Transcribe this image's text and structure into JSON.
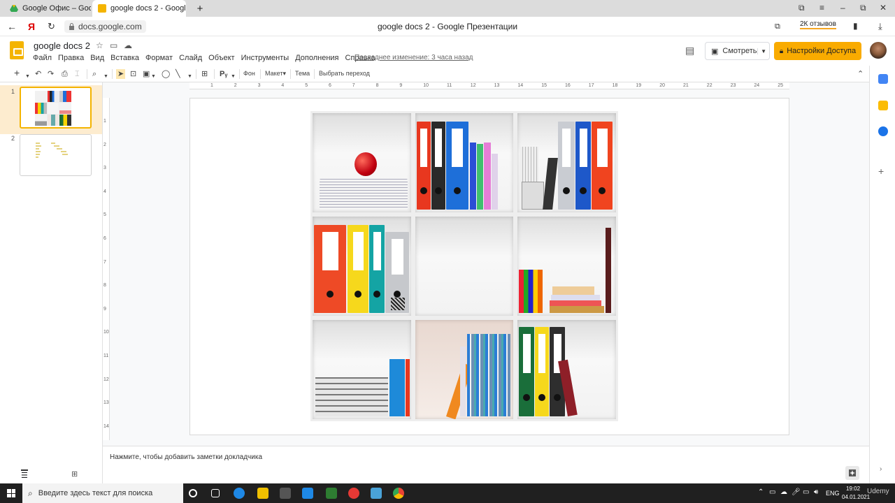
{
  "browser": {
    "tabs": [
      {
        "label": "Google Офис – Google Ди",
        "color": "#4285f4"
      },
      {
        "label": "google docs 2 - Google",
        "color": "#f4b400"
      }
    ],
    "new_tab": "+",
    "close_glyph": "✕",
    "url": "docs.google.com",
    "page_title": "google docs 2 - Google Презентации",
    "reviews": "2К отзывов"
  },
  "doc": {
    "title": "google docs 2",
    "menu": [
      "Файл",
      "Правка",
      "Вид",
      "Вставка",
      "Формат",
      "Слайд",
      "Объект",
      "Инструменты",
      "Дополнения",
      "Справка"
    ],
    "last_edit": "Последнее изменение: 3 часа назад",
    "watch_label": "Смотреть",
    "access_label": "Настройки Доступа",
    "accent": "#f9ab00"
  },
  "toolbar": {
    "background": "Фон",
    "layout": "Макет▾",
    "theme": "Тема",
    "transition": "Выбрать переход"
  },
  "ruler": {
    "h": [
      "1",
      "2",
      "3",
      "4",
      "5",
      "6",
      "7",
      "8",
      "9",
      "10",
      "11",
      "12",
      "13",
      "14",
      "15",
      "16",
      "17",
      "18",
      "19",
      "20",
      "21",
      "22",
      "23",
      "24",
      "25"
    ],
    "v": [
      "1",
      "2",
      "3",
      "4",
      "5",
      "6",
      "7",
      "8",
      "9",
      "10",
      "11",
      "12",
      "13",
      "14"
    ]
  },
  "slides": [
    {
      "number": "1"
    },
    {
      "number": "2"
    }
  ],
  "notes": {
    "placeholder": "Нажмите, чтобы добавить заметки докладчика"
  },
  "taskbar": {
    "search_placeholder": "Введите здесь текст для поиска",
    "lang": "ENG",
    "time": "19:02",
    "date": "04.01.2021",
    "watermark": "Udemy"
  }
}
